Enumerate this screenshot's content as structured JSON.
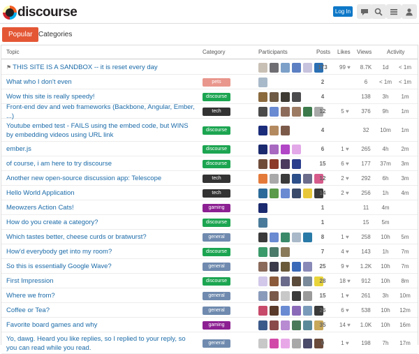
{
  "header": {
    "logo_text": "discourse",
    "login_label": "Log In",
    "icons": [
      "chat-bubble-icon",
      "search-icon",
      "hamburger-menu-icon",
      "user-icon"
    ]
  },
  "nav": {
    "tabs": [
      {
        "label": "Popular",
        "active": true
      },
      {
        "label": "Categories",
        "active": false
      }
    ]
  },
  "table": {
    "columns": [
      "Topic",
      "Category",
      "Participants",
      "Posts",
      "Likes",
      "Views",
      "Activity"
    ],
    "category_colors": {
      "pets": "#e9968c",
      "discourse": "#1ca551",
      "tech": "#333333",
      "gaming": "#8c2092",
      "general": "#6f8aae"
    },
    "rows": [
      {
        "title": "THIS SITE IS A SANDBOX -- it is reset every day",
        "pinned": true,
        "category": "",
        "avatars": [
          "#c9c0b5",
          "#6f6f73",
          "#7ca0c8",
          "#5b7fc2",
          "#c7c2dd",
          "#2a6fb3"
        ],
        "posts": "173",
        "likes": "99",
        "views": "8.7K",
        "act1": "1d",
        "act2": "< 1m"
      },
      {
        "title": "What who I don't even",
        "pinned": false,
        "category": "pets",
        "avatars": [
          "#a8b9c9"
        ],
        "posts": "2",
        "likes": "",
        "views": "6",
        "act1": "< 1m",
        "act2": "< 1m"
      },
      {
        "title": "Wow this site is really speedy!",
        "pinned": false,
        "category": "discourse",
        "avatars": [
          "#8b6a3e",
          "#6e5a45",
          "#3f3a33",
          "#4b4b4e"
        ],
        "posts": "4",
        "likes": "",
        "views": "138",
        "act1": "3h",
        "act2": "1m"
      },
      {
        "title": "Front-end dev and web frameworks (Backbone, Angular, Ember, ...)",
        "pinned": false,
        "category": "tech",
        "avatars": [
          "#4a4a4a",
          "#6a8ad2",
          "#8d6b5a",
          "#9d7b63",
          "#3c7a4c",
          "#a9a9a9"
        ],
        "posts": "12",
        "likes": "5",
        "views": "376",
        "act1": "9h",
        "act2": "1m"
      },
      {
        "title": "Youtube embed test - FAILS using the embed code, but WINS by embedding videos using URL link",
        "pinned": false,
        "category": "discourse",
        "avatars": [
          "#1a2c7a",
          "#b38a60",
          "#7c5a4a"
        ],
        "posts": "4",
        "likes": "",
        "views": "32",
        "act1": "10m",
        "act2": "1m"
      },
      {
        "title": "ember.js",
        "pinned": false,
        "category": "discourse",
        "avatars": [
          "#1b2a6e",
          "#a76ac0",
          "#b146c6",
          "#e2a8e8"
        ],
        "posts": "6",
        "likes": "1",
        "views": "265",
        "act1": "4h",
        "act2": "2m"
      },
      {
        "title": "of course, i am here to try discourse",
        "pinned": false,
        "category": "discourse",
        "avatars": [
          "#6f4c3a",
          "#8c3a2a",
          "#4b3a5e",
          "#2a3c8c"
        ],
        "posts": "15",
        "likes": "6",
        "views": "177",
        "act1": "37m",
        "act2": "3m"
      },
      {
        "title": "Another new open-source discussion app: Telescope",
        "pinned": false,
        "category": "tech",
        "avatars": [
          "#e47a3a",
          "#a9a9a9",
          "#3a3a3a",
          "#2c4f8a",
          "#6b6b8b",
          "#d65b8b"
        ],
        "posts": "12",
        "likes": "2",
        "views": "292",
        "act1": "6h",
        "act2": "3m"
      },
      {
        "title": "Hello World Application",
        "pinned": false,
        "category": "tech",
        "avatars": [
          "#2c6a9a",
          "#5a9a4a",
          "#6a8ad2",
          "#3a4a6a",
          "#e8c83a",
          "#3a3a3a"
        ],
        "posts": "14",
        "likes": "2",
        "views": "256",
        "act1": "1h",
        "act2": "4m"
      },
      {
        "title": "Meowzers Action Cats!",
        "pinned": false,
        "category": "gaming",
        "avatars": [
          "#1b2a6e"
        ],
        "posts": "1",
        "likes": "",
        "views": "11",
        "act1": "4m",
        "act2": ""
      },
      {
        "title": "How do you create a category?",
        "pinned": false,
        "category": "discourse",
        "avatars": [
          "#4a7a9a"
        ],
        "posts": "1",
        "likes": "",
        "views": "15",
        "act1": "5m",
        "act2": ""
      },
      {
        "title": "Which tastes better, cheese curds or bratwurst?",
        "pinned": false,
        "category": "general",
        "avatars": [
          "#3a3a3a",
          "#6a8ad2",
          "#3a8a6a",
          "#a9b9c9",
          "#2a7aa8"
        ],
        "posts": "8",
        "likes": "1",
        "views": "258",
        "act1": "10h",
        "act2": "5m"
      },
      {
        "title": "How'd everybody get into my room?",
        "pinned": false,
        "category": "discourse",
        "avatars": [
          "#3a9a6a",
          "#4a7a6a",
          "#8a7a5a"
        ],
        "posts": "7",
        "likes": "4",
        "views": "143",
        "act1": "1h",
        "act2": "7m"
      },
      {
        "title": "So this is essentially Google Wave?",
        "pinned": false,
        "category": "general",
        "avatars": [
          "#8a6a5a",
          "#3a3a4a",
          "#6a5a3a",
          "#3a6ab8",
          "#8a8ab8"
        ],
        "posts": "25",
        "likes": "9",
        "views": "1.2K",
        "act1": "10h",
        "act2": "7m"
      },
      {
        "title": "First Impression",
        "pinned": false,
        "category": "discourse",
        "avatars": [
          "#d2c8ea",
          "#8a5a3a",
          "#6a6a8a",
          "#5a4a3a",
          "#7a8a9a",
          "#e8d43a"
        ],
        "posts": "28",
        "likes": "18",
        "views": "912",
        "act1": "10h",
        "act2": "8m"
      },
      {
        "title": "Where we from?",
        "pinned": false,
        "category": "general",
        "avatars": [
          "#8a9aba",
          "#7a5a4a",
          "#c8c8c8",
          "#3a3a3a",
          "#9a9a9a"
        ],
        "posts": "15",
        "likes": "1",
        "views": "261",
        "act1": "3h",
        "act2": "10m"
      },
      {
        "title": "Coffee or Tea?",
        "pinned": false,
        "category": "general",
        "avatars": [
          "#c84a6a",
          "#5a3a2a",
          "#6a8ad2",
          "#8a6ab8",
          "#7a9aba",
          "#3a3a3a"
        ],
        "posts": "26",
        "likes": "6",
        "views": "538",
        "act1": "10h",
        "act2": "12m"
      },
      {
        "title": "Favorite board games and why",
        "pinned": false,
        "category": "gaming",
        "avatars": [
          "#3a5a8a",
          "#8a4a4a",
          "#b88ad2",
          "#4a7a5a",
          "#5a8a9a",
          "#c8a85a"
        ],
        "posts": "35",
        "likes": "14",
        "views": "1.0K",
        "act1": "10h",
        "act2": "16m"
      },
      {
        "title": "Yo, dawg. Heard you like replies, so I replied to your reply, so you can read while you read.",
        "pinned": false,
        "category": "general",
        "avatars": [
          "#c8c8c8",
          "#d24aa8",
          "#e8a8e8",
          "#a8a8a8",
          "#4a4a6a",
          "#6a4a3a"
        ],
        "posts": "9",
        "likes": "1",
        "views": "198",
        "act1": "7h",
        "act2": "17m"
      }
    ]
  }
}
